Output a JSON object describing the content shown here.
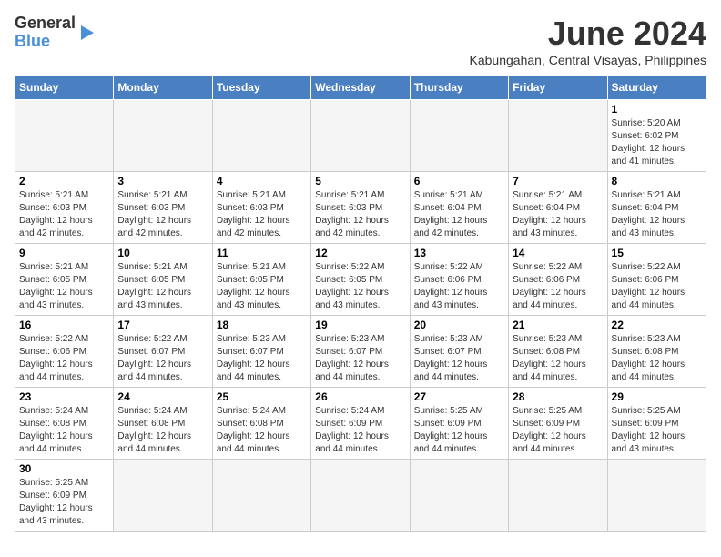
{
  "header": {
    "logo_general": "General",
    "logo_blue": "Blue",
    "month_title": "June 2024",
    "location": "Kabungahan, Central Visayas, Philippines"
  },
  "weekdays": [
    "Sunday",
    "Monday",
    "Tuesday",
    "Wednesday",
    "Thursday",
    "Friday",
    "Saturday"
  ],
  "days": [
    {
      "date": "",
      "info": ""
    },
    {
      "date": "",
      "info": ""
    },
    {
      "date": "",
      "info": ""
    },
    {
      "date": "",
      "info": ""
    },
    {
      "date": "",
      "info": ""
    },
    {
      "date": "",
      "info": ""
    },
    {
      "date": "1",
      "info": "Sunrise: 5:20 AM\nSunset: 6:02 PM\nDaylight: 12 hours and 41 minutes."
    },
    {
      "date": "2",
      "info": "Sunrise: 5:21 AM\nSunset: 6:03 PM\nDaylight: 12 hours and 42 minutes."
    },
    {
      "date": "3",
      "info": "Sunrise: 5:21 AM\nSunset: 6:03 PM\nDaylight: 12 hours and 42 minutes."
    },
    {
      "date": "4",
      "info": "Sunrise: 5:21 AM\nSunset: 6:03 PM\nDaylight: 12 hours and 42 minutes."
    },
    {
      "date": "5",
      "info": "Sunrise: 5:21 AM\nSunset: 6:03 PM\nDaylight: 12 hours and 42 minutes."
    },
    {
      "date": "6",
      "info": "Sunrise: 5:21 AM\nSunset: 6:04 PM\nDaylight: 12 hours and 42 minutes."
    },
    {
      "date": "7",
      "info": "Sunrise: 5:21 AM\nSunset: 6:04 PM\nDaylight: 12 hours and 43 minutes."
    },
    {
      "date": "8",
      "info": "Sunrise: 5:21 AM\nSunset: 6:04 PM\nDaylight: 12 hours and 43 minutes."
    },
    {
      "date": "9",
      "info": "Sunrise: 5:21 AM\nSunset: 6:05 PM\nDaylight: 12 hours and 43 minutes."
    },
    {
      "date": "10",
      "info": "Sunrise: 5:21 AM\nSunset: 6:05 PM\nDaylight: 12 hours and 43 minutes."
    },
    {
      "date": "11",
      "info": "Sunrise: 5:21 AM\nSunset: 6:05 PM\nDaylight: 12 hours and 43 minutes."
    },
    {
      "date": "12",
      "info": "Sunrise: 5:22 AM\nSunset: 6:05 PM\nDaylight: 12 hours and 43 minutes."
    },
    {
      "date": "13",
      "info": "Sunrise: 5:22 AM\nSunset: 6:06 PM\nDaylight: 12 hours and 43 minutes."
    },
    {
      "date": "14",
      "info": "Sunrise: 5:22 AM\nSunset: 6:06 PM\nDaylight: 12 hours and 44 minutes."
    },
    {
      "date": "15",
      "info": "Sunrise: 5:22 AM\nSunset: 6:06 PM\nDaylight: 12 hours and 44 minutes."
    },
    {
      "date": "16",
      "info": "Sunrise: 5:22 AM\nSunset: 6:06 PM\nDaylight: 12 hours and 44 minutes."
    },
    {
      "date": "17",
      "info": "Sunrise: 5:22 AM\nSunset: 6:07 PM\nDaylight: 12 hours and 44 minutes."
    },
    {
      "date": "18",
      "info": "Sunrise: 5:23 AM\nSunset: 6:07 PM\nDaylight: 12 hours and 44 minutes."
    },
    {
      "date": "19",
      "info": "Sunrise: 5:23 AM\nSunset: 6:07 PM\nDaylight: 12 hours and 44 minutes."
    },
    {
      "date": "20",
      "info": "Sunrise: 5:23 AM\nSunset: 6:07 PM\nDaylight: 12 hours and 44 minutes."
    },
    {
      "date": "21",
      "info": "Sunrise: 5:23 AM\nSunset: 6:08 PM\nDaylight: 12 hours and 44 minutes."
    },
    {
      "date": "22",
      "info": "Sunrise: 5:23 AM\nSunset: 6:08 PM\nDaylight: 12 hours and 44 minutes."
    },
    {
      "date": "23",
      "info": "Sunrise: 5:24 AM\nSunset: 6:08 PM\nDaylight: 12 hours and 44 minutes."
    },
    {
      "date": "24",
      "info": "Sunrise: 5:24 AM\nSunset: 6:08 PM\nDaylight: 12 hours and 44 minutes."
    },
    {
      "date": "25",
      "info": "Sunrise: 5:24 AM\nSunset: 6:08 PM\nDaylight: 12 hours and 44 minutes."
    },
    {
      "date": "26",
      "info": "Sunrise: 5:24 AM\nSunset: 6:09 PM\nDaylight: 12 hours and 44 minutes."
    },
    {
      "date": "27",
      "info": "Sunrise: 5:25 AM\nSunset: 6:09 PM\nDaylight: 12 hours and 44 minutes."
    },
    {
      "date": "28",
      "info": "Sunrise: 5:25 AM\nSunset: 6:09 PM\nDaylight: 12 hours and 44 minutes."
    },
    {
      "date": "29",
      "info": "Sunrise: 5:25 AM\nSunset: 6:09 PM\nDaylight: 12 hours and 43 minutes."
    },
    {
      "date": "30",
      "info": "Sunrise: 5:25 AM\nSunset: 6:09 PM\nDaylight: 12 hours and 43 minutes."
    }
  ]
}
